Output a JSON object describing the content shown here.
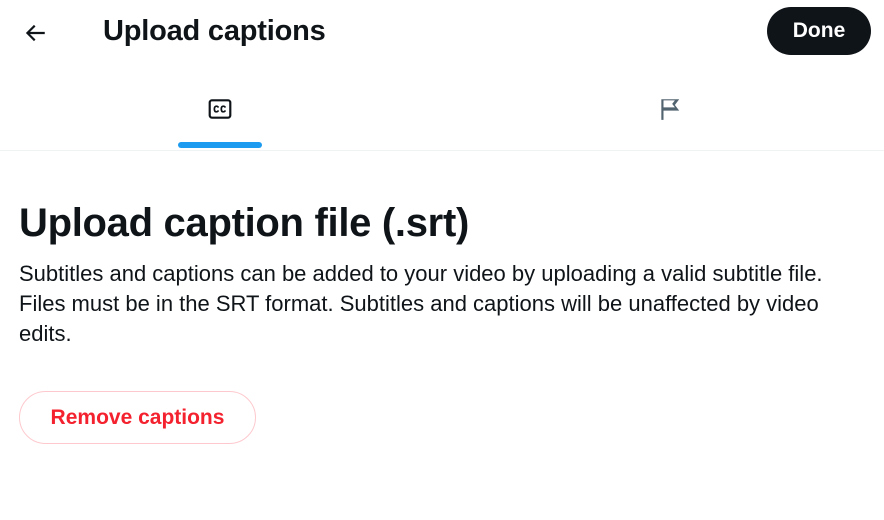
{
  "header": {
    "back_icon": "arrow-left-icon",
    "title": "Upload captions",
    "done_label": "Done"
  },
  "tabs": [
    {
      "icon": "closed-captions-icon",
      "selected": true
    },
    {
      "icon": "flag-icon",
      "selected": false
    }
  ],
  "section": {
    "heading": "Upload caption file (.srt)",
    "description": "Subtitles and captions can be added to your video by uploading a valid subtitle file. Files must be in the SRT format. Subtitles and captions will be unaffected by video edits.",
    "remove_label": "Remove captions"
  },
  "colors": {
    "accent": "#1d9bf0",
    "text": "#0f1419",
    "danger": "#f4212e",
    "danger_border": "#fdc9ce",
    "divider": "#eff3f4"
  }
}
